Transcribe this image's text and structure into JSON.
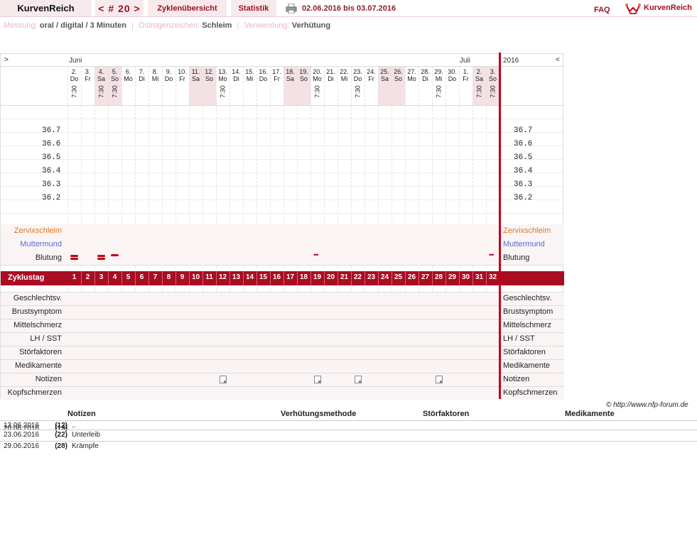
{
  "nav": {
    "brand": "KurvenReich",
    "cycle_nav": "< # 20 >",
    "overview": "Zyklenübersicht",
    "stats": "Statistik",
    "date_range": "02.06.2016 bis 03.07.2016",
    "faq": "FAQ",
    "logo_text": "KurvenReich"
  },
  "meta": {
    "measurement_label": "Messung:",
    "measurement_value": "oral / digital / 3 Minuten",
    "estrogen_label": "Östrogenzeichen:",
    "estrogen_value": "Schleim",
    "use_label": "Verwendung:",
    "use_value": "Verhütung"
  },
  "chart": {
    "arrow_left": ">",
    "arrow_right": "<",
    "month_1": "Juni",
    "month_2": "Juli",
    "year": "2016",
    "days": [
      {
        "d": "2.",
        "w": "Do",
        "t": "7:30"
      },
      {
        "d": "3.",
        "w": "Fr",
        "t": ""
      },
      {
        "d": "4.",
        "w": "Sa",
        "t": "7:30"
      },
      {
        "d": "5.",
        "w": "So",
        "t": "7:30"
      },
      {
        "d": "6.",
        "w": "Mo",
        "t": ""
      },
      {
        "d": "7.",
        "w": "Di",
        "t": ""
      },
      {
        "d": "8.",
        "w": "Mi",
        "t": ""
      },
      {
        "d": "9.",
        "w": "Do",
        "t": ""
      },
      {
        "d": "10.",
        "w": "Fr",
        "t": ""
      },
      {
        "d": "11.",
        "w": "Sa",
        "t": ""
      },
      {
        "d": "12.",
        "w": "So",
        "t": ""
      },
      {
        "d": "13.",
        "w": "Mo",
        "t": "7:30"
      },
      {
        "d": "14.",
        "w": "Di",
        "t": ""
      },
      {
        "d": "15.",
        "w": "Mi",
        "t": ""
      },
      {
        "d": "16.",
        "w": "Do",
        "t": ""
      },
      {
        "d": "17.",
        "w": "Fr",
        "t": ""
      },
      {
        "d": "18.",
        "w": "Sa",
        "t": ""
      },
      {
        "d": "19.",
        "w": "So",
        "t": ""
      },
      {
        "d": "20.",
        "w": "Mo",
        "t": "7:30"
      },
      {
        "d": "21.",
        "w": "Di",
        "t": ""
      },
      {
        "d": "22.",
        "w": "Mi",
        "t": ""
      },
      {
        "d": "23.",
        "w": "Do",
        "t": "7:30"
      },
      {
        "d": "24.",
        "w": "Fr",
        "t": ""
      },
      {
        "d": "25.",
        "w": "Sa",
        "t": ""
      },
      {
        "d": "26.",
        "w": "So",
        "t": ""
      },
      {
        "d": "27.",
        "w": "Mo",
        "t": ""
      },
      {
        "d": "28.",
        "w": "Di",
        "t": ""
      },
      {
        "d": "29.",
        "w": "Mi",
        "t": "7:30"
      },
      {
        "d": "30.",
        "w": "Do",
        "t": ""
      },
      {
        "d": "1.",
        "w": "Fr",
        "t": ""
      },
      {
        "d": "2.",
        "w": "Sa",
        "t": "7:30"
      },
      {
        "d": "3.",
        "w": "So",
        "t": "7:30"
      }
    ],
    "weekend_flags": [
      0,
      0,
      1,
      1,
      0,
      0,
      0,
      0,
      0,
      1,
      1,
      0,
      0,
      0,
      0,
      0,
      1,
      1,
      0,
      0,
      0,
      0,
      0,
      1,
      1,
      0,
      0,
      0,
      0,
      0,
      1,
      1
    ],
    "temp_labels": [
      "36.7",
      "36.6",
      "36.5",
      "36.4",
      "36.3",
      "36.2"
    ],
    "row_labels": {
      "cervical": "Zervixschleim",
      "cervix": "Muttermund",
      "bleeding": "Blutung",
      "cycle_day": "Zyklustag",
      "intercourse": "Geschlechtsv.",
      "breast": "Brustsymptom",
      "midpain": "Mittelschmerz",
      "lh": "LH / SST",
      "disturb": "Störfaktoren",
      "meds": "Medikamente",
      "notes": "Notizen",
      "headache": "Kopfschmerzen"
    },
    "cervical_color": "#e07820",
    "cervix_color": "#5a6ad0",
    "accent_color": "#a80d22",
    "cycle_days": [
      "1",
      "2",
      "3",
      "4",
      "5",
      "6",
      "7",
      "8",
      "9",
      "10",
      "11",
      "12",
      "13",
      "14",
      "15",
      "16",
      "17",
      "18",
      "19",
      "20",
      "21",
      "22",
      "23",
      "24",
      "25",
      "26",
      "27",
      "28",
      "29",
      "30",
      "31",
      "32"
    ],
    "bleeding": [
      {
        "day": 1,
        "kind": "heavy"
      },
      {
        "day": 3,
        "kind": "heavy"
      },
      {
        "day": 4,
        "kind": "light"
      },
      {
        "day": 19,
        "kind": "spot"
      },
      {
        "day": 32,
        "kind": "spot"
      }
    ],
    "note_days": [
      12,
      19,
      22,
      28
    ]
  },
  "copyright": "© http://www.nfp-forum.de",
  "notes_table": {
    "headers": [
      "Notizen",
      "Verhütungsmethode",
      "Störfaktoren",
      "Medikamente"
    ],
    "rows": [
      {
        "date": "13.06.2016",
        "num": "(12)",
        "text": ".."
      },
      {
        "date": "20.06.2016",
        "num": "(19)",
        "text": ""
      },
      {
        "date": "23.06.2016",
        "num": "(22)",
        "text": "Unterleib"
      },
      {
        "date": "29.06.2016",
        "num": "(28)",
        "text": "Krämpfe"
      }
    ]
  }
}
